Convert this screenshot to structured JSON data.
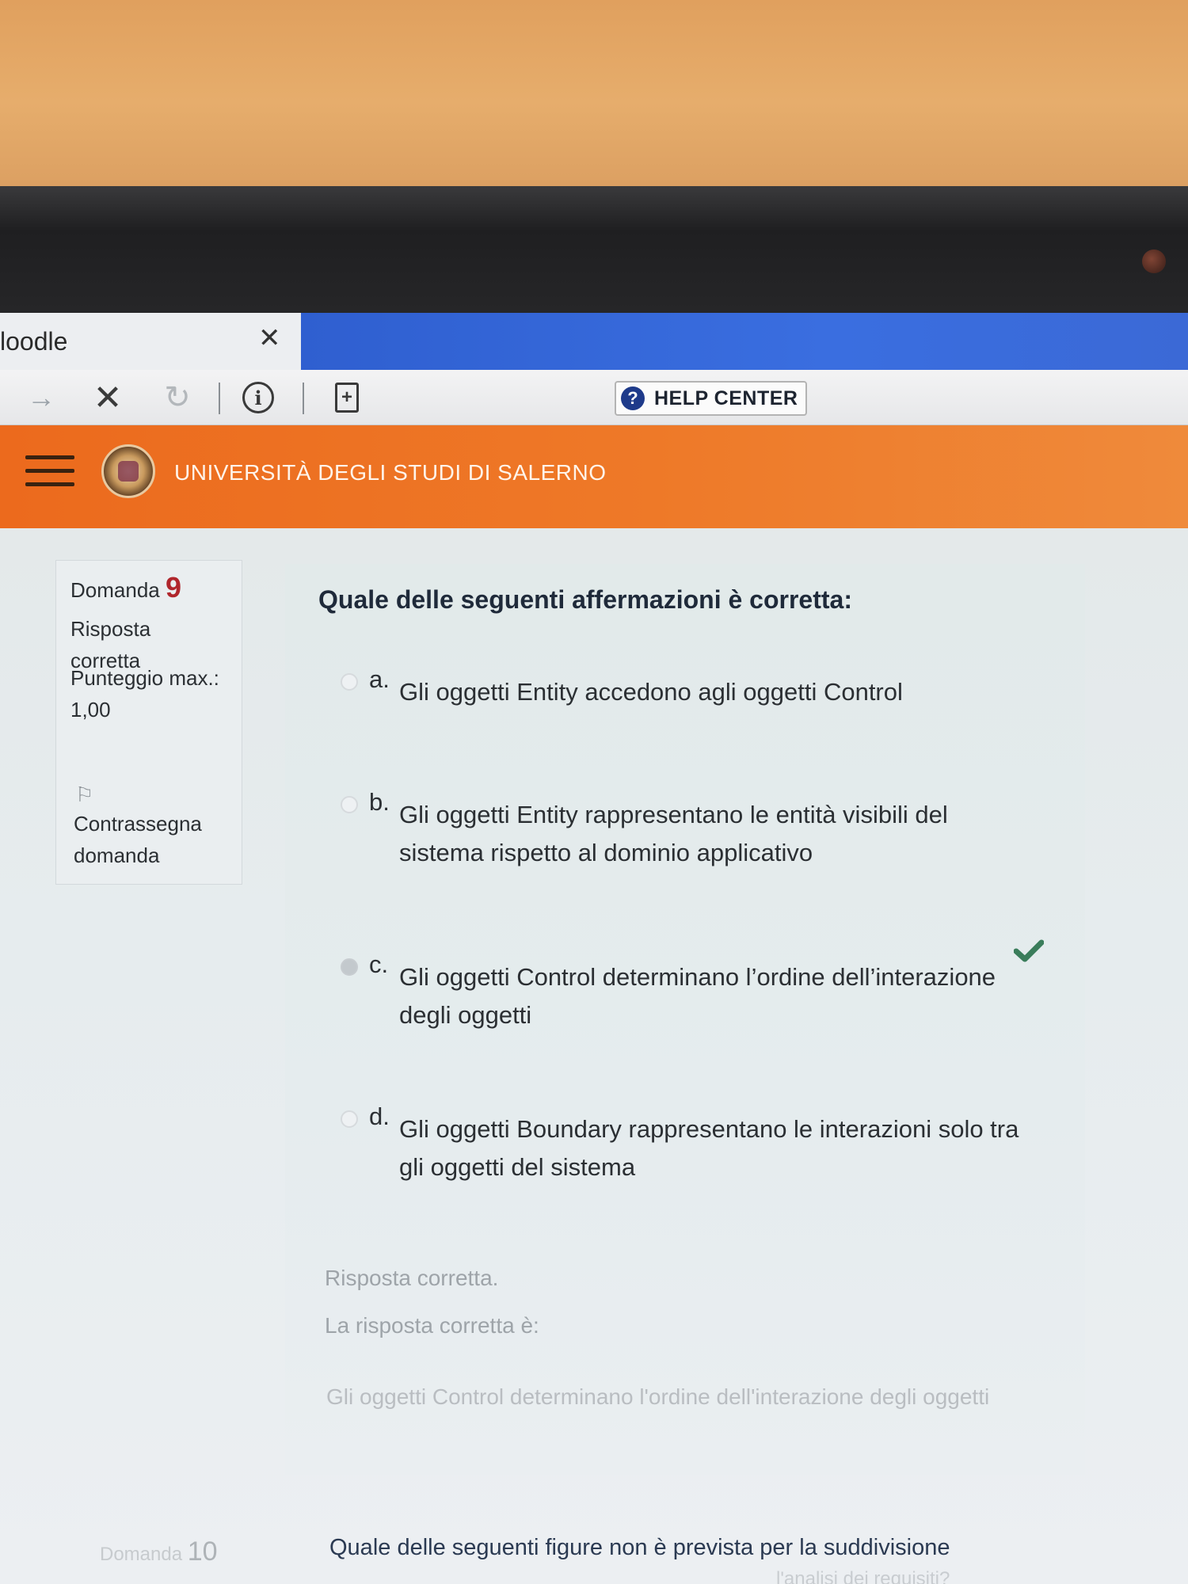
{
  "browser": {
    "tab_title": "loodle",
    "tab_close": "✕",
    "help_center": "HELP CENTER"
  },
  "site": {
    "university": "UNIVERSITÀ DEGLI STUDI DI SALERNO"
  },
  "question_info": {
    "label": "Domanda",
    "number": "9",
    "state": "Risposta corretta",
    "grade_label": "Punteggio max.:",
    "grade_value": "1,00",
    "flag_label": "Contrassegna domanda"
  },
  "question": {
    "text": "Quale delle seguenti affermazioni è corretta:",
    "options": [
      {
        "letter": "a.",
        "text": "Gli oggetti Entity accedono agli oggetti Control",
        "selected": false
      },
      {
        "letter": "b.",
        "text": "Gli oggetti Entity rappresentano le entità visibili del sistema rispetto al dominio applicativo",
        "selected": false
      },
      {
        "letter": "c.",
        "text": "Gli oggetti Control determinano l’ordine dell’interazione degli oggetti",
        "selected": true
      },
      {
        "letter": "d.",
        "text": "Gli oggetti Boundary rappresentano le interazioni solo tra gli oggetti del sistema",
        "selected": false
      }
    ]
  },
  "feedback": {
    "result": "Risposta corretta.",
    "correct_label": "La risposta corretta è:",
    "correct_answer": "Gli oggetti Control determinano l'ordine dell'interazione degli oggetti"
  },
  "next_question": {
    "label": "Domanda",
    "number": "10",
    "text": "Quale delle seguenti figure non è prevista per la suddivisione",
    "partial_text": "l'analisi dei requisiti?"
  },
  "colors": {
    "header_orange": "#ee7928",
    "tab_blue": "#3a6ee0",
    "check_green": "#3a7d5b"
  },
  "icons": [
    "forward-icon",
    "stop-icon",
    "reload-icon",
    "info-icon",
    "new-page-icon",
    "help-icon",
    "menu-icon",
    "university-logo",
    "flag-icon",
    "checkmark-icon"
  ]
}
